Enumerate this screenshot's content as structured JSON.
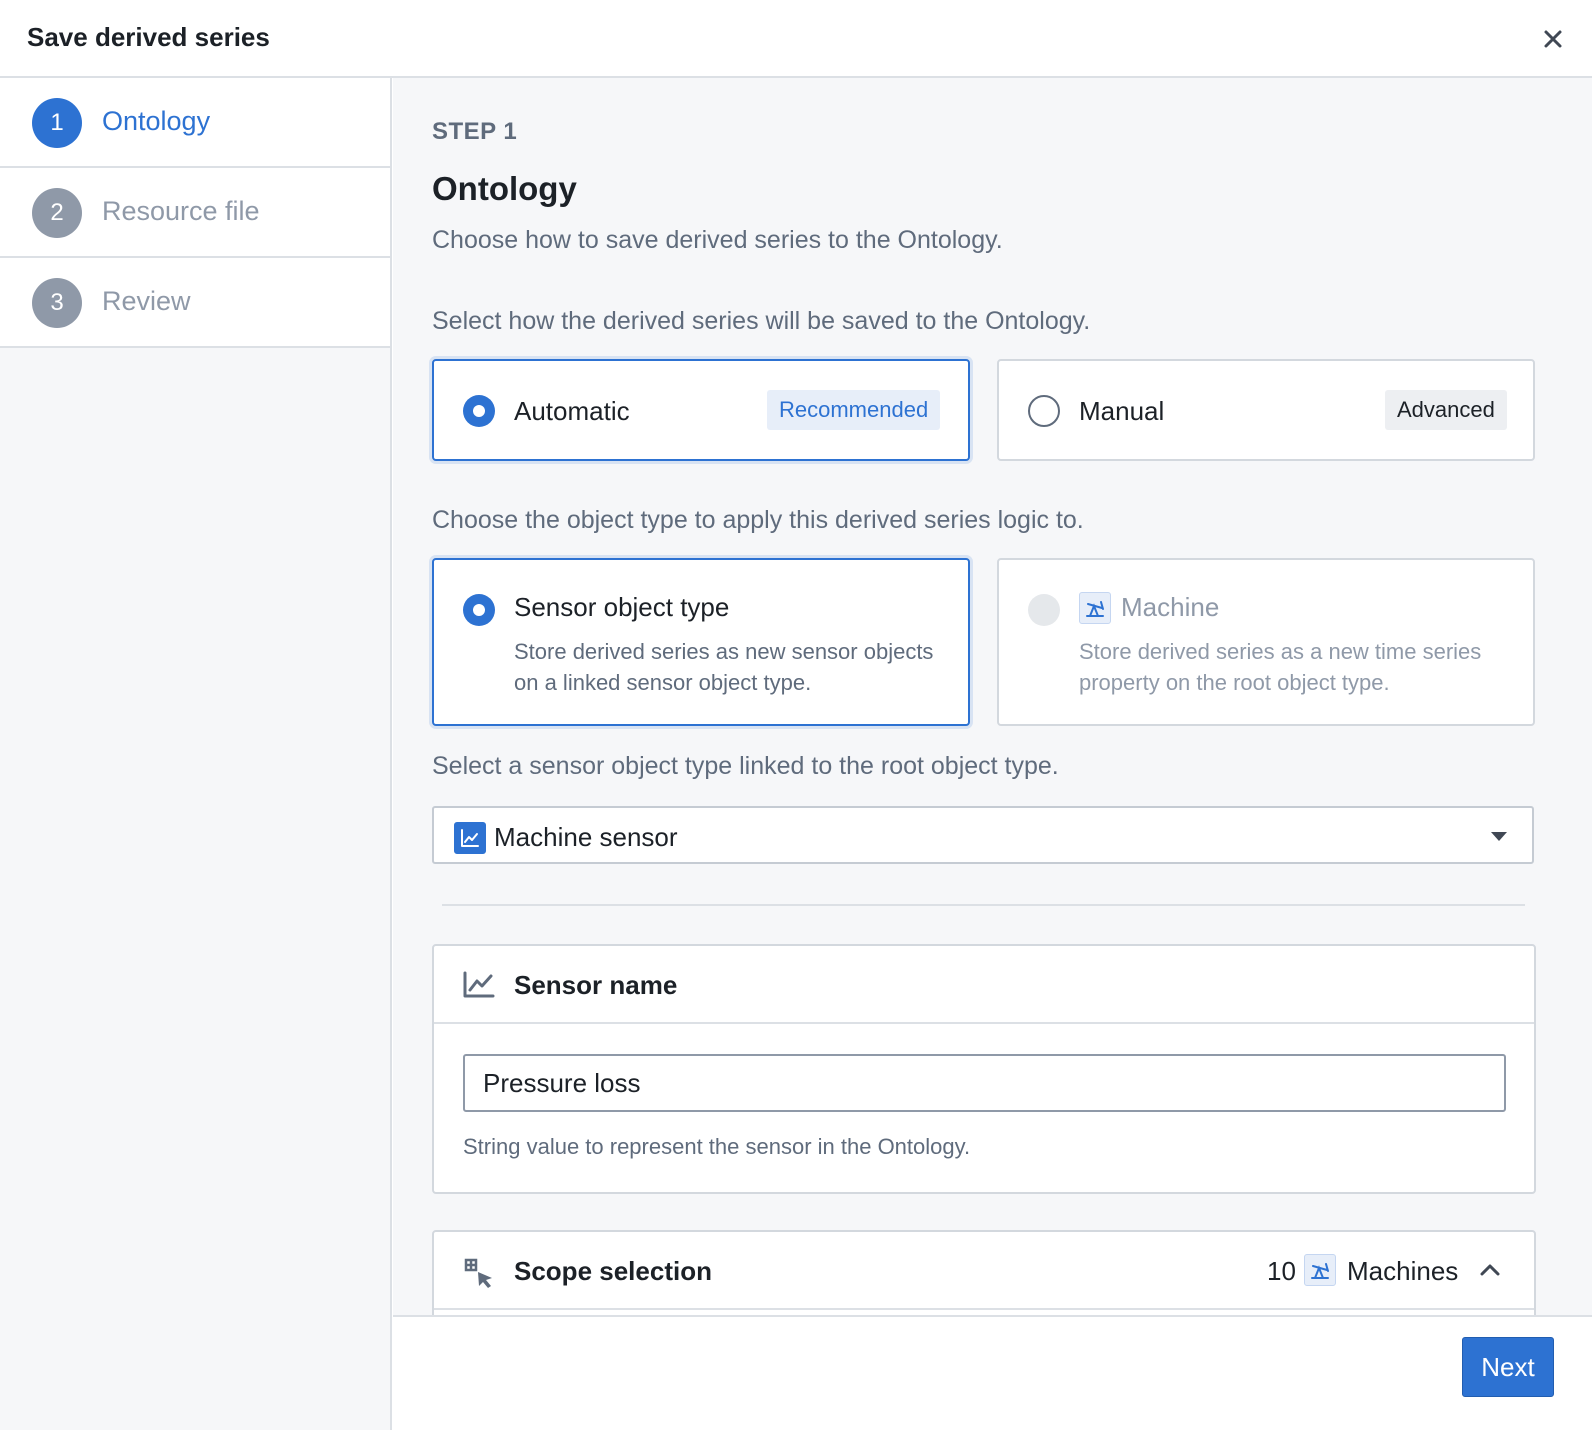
{
  "dialog": {
    "title": "Save derived series"
  },
  "steps": [
    {
      "number": "1",
      "label": "Ontology",
      "state": "active"
    },
    {
      "number": "2",
      "label": "Resource file",
      "state": "inactive"
    },
    {
      "number": "3",
      "label": "Review",
      "state": "inactive"
    }
  ],
  "content": {
    "step_label": "STEP 1",
    "heading": "Ontology",
    "subtitle": "Choose how to save derived series to the Ontology.",
    "save_mode_question": "Select how the derived series will be saved to the Ontology.",
    "save_modes": [
      {
        "label": "Automatic",
        "tag": "Recommended",
        "selected": true
      },
      {
        "label": "Manual",
        "tag": "Advanced",
        "selected": false
      }
    ],
    "object_type_question": "Choose the object type to apply this derived series logic to.",
    "object_types": [
      {
        "label": "Sensor object type",
        "description": "Store derived series as new sensor objects on a linked sensor object type.",
        "selected": true,
        "disabled": false
      },
      {
        "label": "Machine",
        "description": "Store derived series as a new time series property on the root object type.",
        "selected": false,
        "disabled": true
      }
    ],
    "sensor_type_question": "Select a sensor object type linked to the root object type.",
    "sensor_type_select": {
      "value": "Machine sensor"
    },
    "sensor_name_panel": {
      "title": "Sensor name",
      "input_value": "Pressure loss",
      "helper": "String value to represent the sensor in the Ontology."
    },
    "scope_panel": {
      "title": "Scope selection",
      "count": "10",
      "object_label": "Machines",
      "expanded": true
    }
  },
  "footer": {
    "next_label": "Next"
  },
  "colors": {
    "primary": "#2d72d2",
    "muted": "#8f99a8",
    "text": "#1c2127",
    "secondary_text": "#5f6b7c",
    "border": "#d3d8de",
    "background": "#f6f7f9"
  },
  "icons": {
    "close": "close-icon",
    "time_series": "line-chart-icon",
    "machine": "pump-jack-icon",
    "select_caret": "caret-down-icon",
    "scope": "select-cursor-icon",
    "chevron": "chevron-up-icon"
  }
}
